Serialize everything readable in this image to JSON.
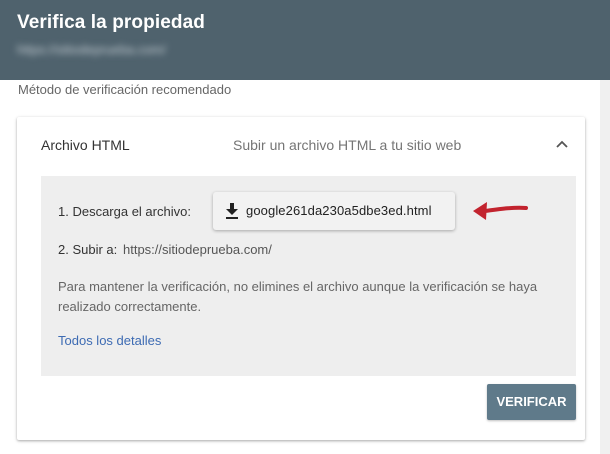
{
  "header": {
    "title": "Verifica la propiedad",
    "url": "https://sitiodeprueba.com/"
  },
  "subtitle": "Método de verificación recomendado",
  "card": {
    "title": "Archivo HTML",
    "description": "Subir un archivo HTML a tu sitio web",
    "expanded": true,
    "step1_label": "1. Descarga el archivo:",
    "download_filename": "google261da230a5dbe3ed.html",
    "step2_label": "2. Subir a:",
    "step2_url": "https://sitiodeprueba.com/",
    "note": "Para mantener la verificación, no elimines el archivo aunque la verificación se haya realizado correctamente.",
    "details_link": "Todos los detalles",
    "verify_button": "VERIFICAR"
  },
  "icons": {
    "download": "download-icon",
    "chevron": "chevron-up-icon",
    "annotation_arrow": "red-arrow-annotation"
  },
  "colors": {
    "header_bg": "#4f626d",
    "verify_button_bg": "#5f7a8a",
    "link": "#3d6bb3",
    "annotation_arrow": "#c2232e"
  }
}
